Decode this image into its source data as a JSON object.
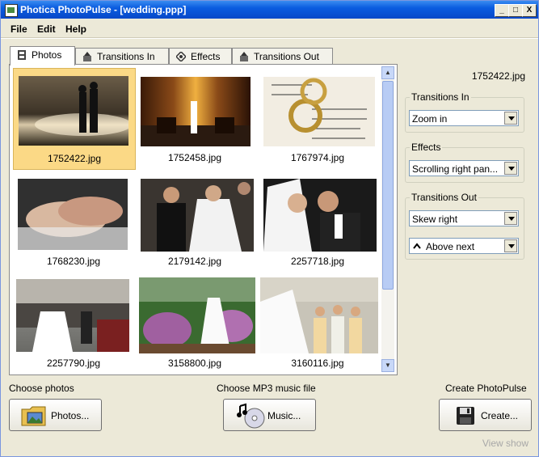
{
  "window": {
    "title": "Photica PhotoPulse - [wedding.ppp]"
  },
  "titlebar_buttons": {
    "minimize": "_",
    "maximize": "□",
    "close": "X"
  },
  "menu": [
    "File",
    "Edit",
    "Help"
  ],
  "tabs": [
    "Photos",
    "Transitions In",
    "Effects",
    "Transitions Out"
  ],
  "photos": [
    {
      "file": "1752422.jpg",
      "selected": true
    },
    {
      "file": "1752458.jpg"
    },
    {
      "file": "1767974.jpg"
    },
    {
      "file": "1768230.jpg"
    },
    {
      "file": "2179142.jpg"
    },
    {
      "file": "2257718.jpg"
    },
    {
      "file": "2257790.jpg"
    },
    {
      "file": "3158800.jpg"
    },
    {
      "file": "3160116.jpg"
    }
  ],
  "side": {
    "selected_file": "1752422.jpg",
    "transitions_in": {
      "label": "Transitions In",
      "value": "Zoom in"
    },
    "effects": {
      "label": "Effects",
      "value": "Scrolling right pan..."
    },
    "transitions_out": {
      "label": "Transitions Out",
      "value": "Skew right",
      "value2": "Above next"
    }
  },
  "bottom": {
    "choose_photos_label": "Choose photos",
    "photos_button": "Photos...",
    "choose_music_label": "Choose MP3 music file",
    "music_button": "Music...",
    "create_label": "Create PhotoPulse",
    "create_button": "Create...",
    "view_show": "View show"
  }
}
